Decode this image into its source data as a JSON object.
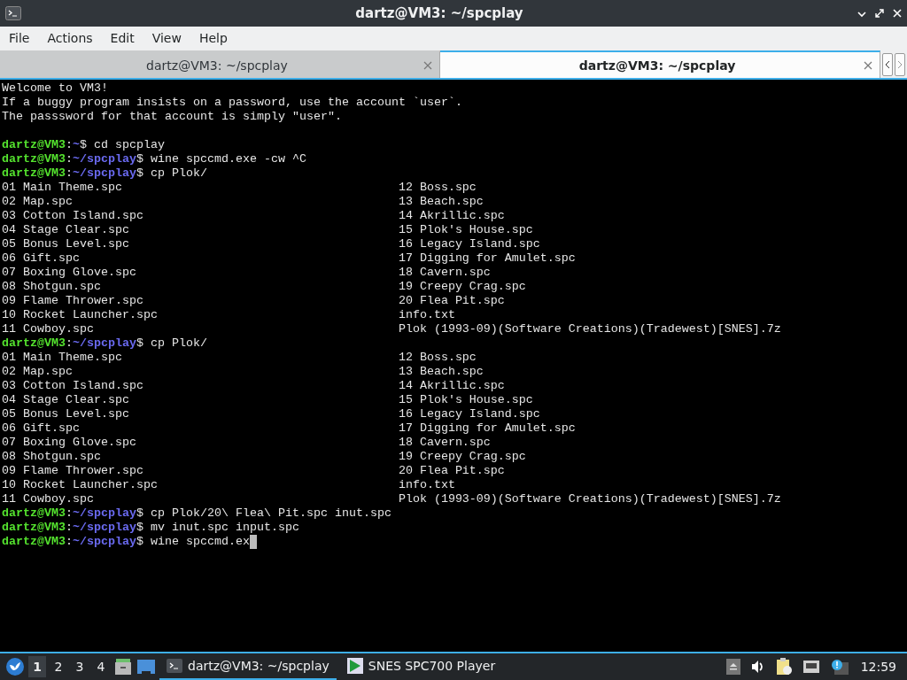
{
  "window": {
    "title": "dartz@VM3: ~/spcplay"
  },
  "menu": [
    "File",
    "Actions",
    "Edit",
    "View",
    "Help"
  ],
  "tabs": [
    {
      "label": "dartz@VM3: ~/spcplay",
      "selected": false
    },
    {
      "label": "dartz@VM3: ~/spcplay",
      "selected": true
    }
  ],
  "terminal": {
    "lines": [
      {
        "kind": "text",
        "text": "Welcome to VM3!"
      },
      {
        "kind": "text",
        "text": "If a buggy program insists on a password, use the account `user`."
      },
      {
        "kind": "text",
        "text": "The passsword for that account is simply \"user\"."
      },
      {
        "kind": "blank"
      },
      {
        "kind": "prompt",
        "user": "dartz@VM3",
        "separator": ":",
        "path": "~",
        "sign": "$",
        "command": "cd spcplay"
      },
      {
        "kind": "prompt",
        "user": "dartz@VM3",
        "separator": ":",
        "path": "~/spcplay",
        "sign": "$",
        "command": "wine spccmd.exe -cw ^C"
      },
      {
        "kind": "prompt",
        "user": "dartz@VM3",
        "separator": ":",
        "path": "~/spcplay",
        "sign": "$",
        "command": "cp Plok/"
      },
      {
        "kind": "columns",
        "left": "01 Main Theme.spc",
        "right": "12 Boss.spc"
      },
      {
        "kind": "columns",
        "left": "02 Map.spc",
        "right": "13 Beach.spc"
      },
      {
        "kind": "columns",
        "left": "03 Cotton Island.spc",
        "right": "14 Akrillic.spc"
      },
      {
        "kind": "columns",
        "left": "04 Stage Clear.spc",
        "right": "15 Plok's House.spc"
      },
      {
        "kind": "columns",
        "left": "05 Bonus Level.spc",
        "right": "16 Legacy Island.spc"
      },
      {
        "kind": "columns",
        "left": "06 Gift.spc",
        "right": "17 Digging for Amulet.spc"
      },
      {
        "kind": "columns",
        "left": "07 Boxing Glove.spc",
        "right": "18 Cavern.spc"
      },
      {
        "kind": "columns",
        "left": "08 Shotgun.spc",
        "right": "19 Creepy Crag.spc"
      },
      {
        "kind": "columns",
        "left": "09 Flame Thrower.spc",
        "right": "20 Flea Pit.spc"
      },
      {
        "kind": "columns",
        "left": "10 Rocket Launcher.spc",
        "right": "info.txt"
      },
      {
        "kind": "columns",
        "left": "11 Cowboy.spc",
        "right": "Plok (1993-09)(Software Creations)(Tradewest)[SNES].7z"
      },
      {
        "kind": "prompt",
        "user": "dartz@VM3",
        "separator": ":",
        "path": "~/spcplay",
        "sign": "$",
        "command": "cp Plok/"
      },
      {
        "kind": "columns",
        "left": "01 Main Theme.spc",
        "right": "12 Boss.spc"
      },
      {
        "kind": "columns",
        "left": "02 Map.spc",
        "right": "13 Beach.spc"
      },
      {
        "kind": "columns",
        "left": "03 Cotton Island.spc",
        "right": "14 Akrillic.spc"
      },
      {
        "kind": "columns",
        "left": "04 Stage Clear.spc",
        "right": "15 Plok's House.spc"
      },
      {
        "kind": "columns",
        "left": "05 Bonus Level.spc",
        "right": "16 Legacy Island.spc"
      },
      {
        "kind": "columns",
        "left": "06 Gift.spc",
        "right": "17 Digging for Amulet.spc"
      },
      {
        "kind": "columns",
        "left": "07 Boxing Glove.spc",
        "right": "18 Cavern.spc"
      },
      {
        "kind": "columns",
        "left": "08 Shotgun.spc",
        "right": "19 Creepy Crag.spc"
      },
      {
        "kind": "columns",
        "left": "09 Flame Thrower.spc",
        "right": "20 Flea Pit.spc"
      },
      {
        "kind": "columns",
        "left": "10 Rocket Launcher.spc",
        "right": "info.txt"
      },
      {
        "kind": "columns",
        "left": "11 Cowboy.spc",
        "right": "Plok (1993-09)(Software Creations)(Tradewest)[SNES].7z"
      },
      {
        "kind": "prompt",
        "user": "dartz@VM3",
        "separator": ":",
        "path": "~/spcplay",
        "sign": "$",
        "command": "cp Plok/20\\ Flea\\ Pit.spc inut.spc"
      },
      {
        "kind": "prompt",
        "user": "dartz@VM3",
        "separator": ":",
        "path": "~/spcplay",
        "sign": "$",
        "command": "mv inut.spc input.spc"
      },
      {
        "kind": "prompt",
        "user": "dartz@VM3",
        "separator": ":",
        "path": "~/spcplay",
        "sign": "$",
        "command": "wine spccmd.ex",
        "cursor": true
      }
    ]
  },
  "taskbar": {
    "workspaces": [
      {
        "label": "1",
        "selected": true
      },
      {
        "label": "2",
        "selected": false
      },
      {
        "label": "3",
        "selected": false
      },
      {
        "label": "4",
        "selected": false
      }
    ],
    "tasks": [
      {
        "label": "dartz@VM3: ~/spcplay",
        "kind": "terminal",
        "selected": true
      },
      {
        "label": "SNES SPC700 Player",
        "kind": "player",
        "selected": false
      }
    ],
    "clock": "12:59"
  }
}
